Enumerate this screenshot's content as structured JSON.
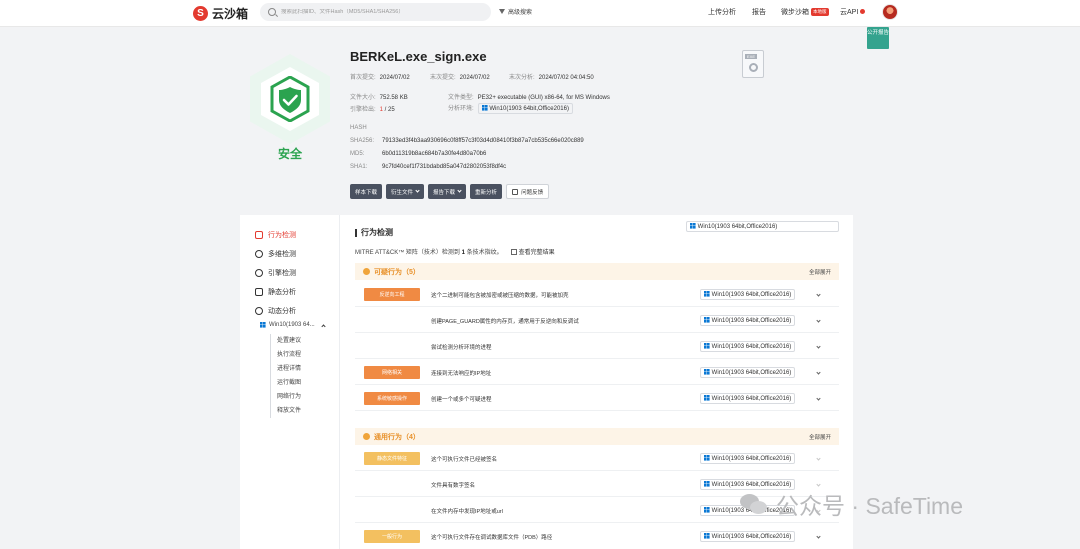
{
  "header": {
    "logo_mark": "S",
    "logo_text": "云沙箱",
    "search_placeholder": "搜索此扫描ID、文件Hash（MD5/SHA1/SHA256）",
    "advanced_search": "高级搜索",
    "nav": {
      "upload": "上传分析",
      "report": "报告",
      "micro_sandbox": "微步沙箱",
      "micro_badge": "本地版",
      "api": "云API"
    },
    "public_report_label": "公开报告"
  },
  "file": {
    "name": "BERKeL.exe_sign.exe",
    "verdict": "安全",
    "first_submit_label": "首次提交:",
    "first_submit": "2024/07/02",
    "last_submit_label": "末次提交:",
    "last_submit": "2024/07/02",
    "last_analysis_label": "末次分析:",
    "last_analysis": "2024/07/02 04:04:50",
    "size_label": "文件大小:",
    "size": "752.58 KB",
    "type_label": "文件类型:",
    "type": "PE32+ executable (GUI) x86-64, for MS Windows",
    "engine_label": "引擎检出:",
    "engine_detected": "1",
    "engine_total": " / 25",
    "env_label": "分析环境:",
    "env": "Win10(1903 64bit,Office2016)",
    "icon_ext": "EXE"
  },
  "hashes": {
    "title": "HASH",
    "sha256_label": "SHA256:",
    "sha256": "79133ed3f4b3aa930696c0f8ff57c3f03d4d08410f3b87a7cb535c66e020c889",
    "md5_label": "MD5:",
    "md5": "6b0d11319b8ac684b7a30fe4d80a70b6",
    "sha1_label": "SHA1:",
    "sha1": "9c7fd40cef1f731bdabd85a047d2802053f8df4c"
  },
  "actions": {
    "download_sample": "样本下载",
    "derived_files": "衍生文件",
    "report_download": "报告下载",
    "reanalyze": "重新分析",
    "feedback": "问题反馈"
  },
  "sidebar": {
    "items": [
      {
        "label": "行为检测"
      },
      {
        "label": "多维检测"
      },
      {
        "label": "引擎检测"
      },
      {
        "label": "静态分析"
      },
      {
        "label": "动态分析"
      }
    ],
    "env_short": "Win10(1903 64...",
    "sub": [
      "处置建议",
      "执行流程",
      "进程详情",
      "运行截图",
      "网络行为",
      "释放文件"
    ]
  },
  "behavior": {
    "title": "行为检测",
    "mitre_prefix": "MITRE ATT&CK™ 矩阵（技术）检测到 ",
    "mitre_count": "1",
    "mitre_suffix": " 条技术指纹。",
    "view_full": "查看完整结果",
    "env": "Win10(1903 64bit,Office2016)",
    "expand_all": "全部展开",
    "categories": [
      {
        "title": "可疑行为（5）",
        "rows": [
          {
            "tag": "反逆向工程",
            "text": "这个二进制可能包含被加密或被压缩的数据，可能被加壳",
            "env": "Win10(1903 64bit,Office2016)"
          },
          {
            "tag": "",
            "text": "创建PAGE_GUARD属性的内存页，通常用于反逆向和反调试",
            "env": "Win10(1903 64bit,Office2016)"
          },
          {
            "tag": "",
            "text": "尝试检测分析环境的进程",
            "env": "Win10(1903 64bit,Office2016)"
          },
          {
            "tag": "网络相关",
            "text": "连接到无法响应的IP地址",
            "env": "Win10(1903 64bit,Office2016)"
          },
          {
            "tag": "系统敏感操作",
            "text": "创建一个或多个可疑进程",
            "env": "Win10(1903 64bit,Office2016)"
          }
        ]
      },
      {
        "title": "通用行为（4）",
        "rows": [
          {
            "tag": "静态文件特征",
            "text": "这个可执行文件已经被签名",
            "env": "Win10(1903 64bit,Office2016)"
          },
          {
            "tag": "",
            "text": "文件具有数字签名",
            "env": "Win10(1903 64bit,Office2016)"
          },
          {
            "tag": "",
            "text": "在文件内存中发现IP地址或url",
            "env": "Win10(1903 64bit,Office2016)"
          },
          {
            "tag": "一般行为",
            "text": "这个可执行文件存在调试数据库文件（PDB）路径",
            "env": "Win10(1903 64bit,Office2016)"
          }
        ]
      }
    ]
  },
  "watermark": "公众号 · SafeTime",
  "colors": {
    "brand_red": "#e33a2f",
    "safe_green": "#2ba34f",
    "orange_tag": "#f08a43",
    "yellow_tag": "#f3c060",
    "teal": "#34a38e"
  }
}
